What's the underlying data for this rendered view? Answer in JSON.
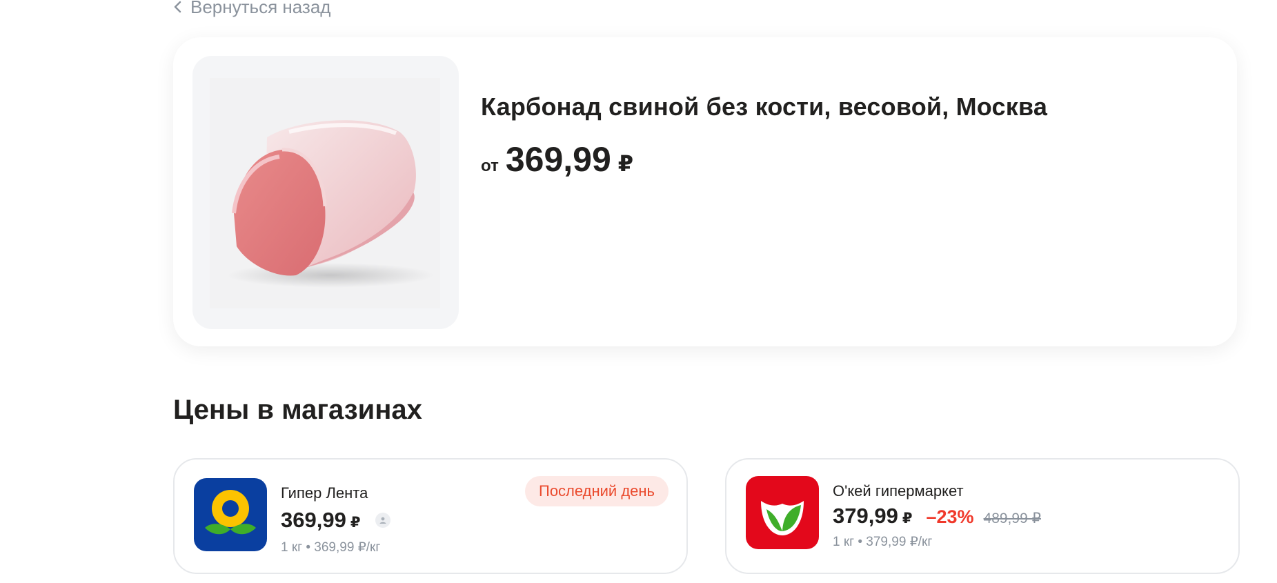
{
  "back_link": {
    "label": "Вернуться назад",
    "icon": "chevron-left-icon"
  },
  "product": {
    "title": "Карбонад свиной без кости, весовой, Москва",
    "price_prefix": "от",
    "price_value": "369,99",
    "currency": "₽",
    "image": "pork-loin-photo"
  },
  "stores_section": {
    "title": "Цены в магазинах",
    "stores": [
      {
        "name": "Гипер Лента",
        "price": "369,99",
        "currency": "₽",
        "unit_price": "1 кг • 369,99 ₽/кг",
        "badge": "Последний день",
        "logo": "lenta-logo"
      },
      {
        "name": "О'кей гипермаркет",
        "price": "379,99",
        "currency": "₽",
        "discount": "–23%",
        "old_price": "489,99 ₽",
        "unit_price": "1 кг • 379,99 ₽/кг",
        "logo": "okey-logo"
      }
    ]
  },
  "colors": {
    "text_primary": "#21201f",
    "text_secondary": "#8a929c",
    "discount_red": "#f0392b",
    "badge_bg": "#fde9e6",
    "badge_text": "#ea4a2d",
    "lenta_blue": "#0a3fa0",
    "lenta_yellow": "#fcc300",
    "okey_red": "#e3081b",
    "okey_green": "#3fae2a"
  }
}
